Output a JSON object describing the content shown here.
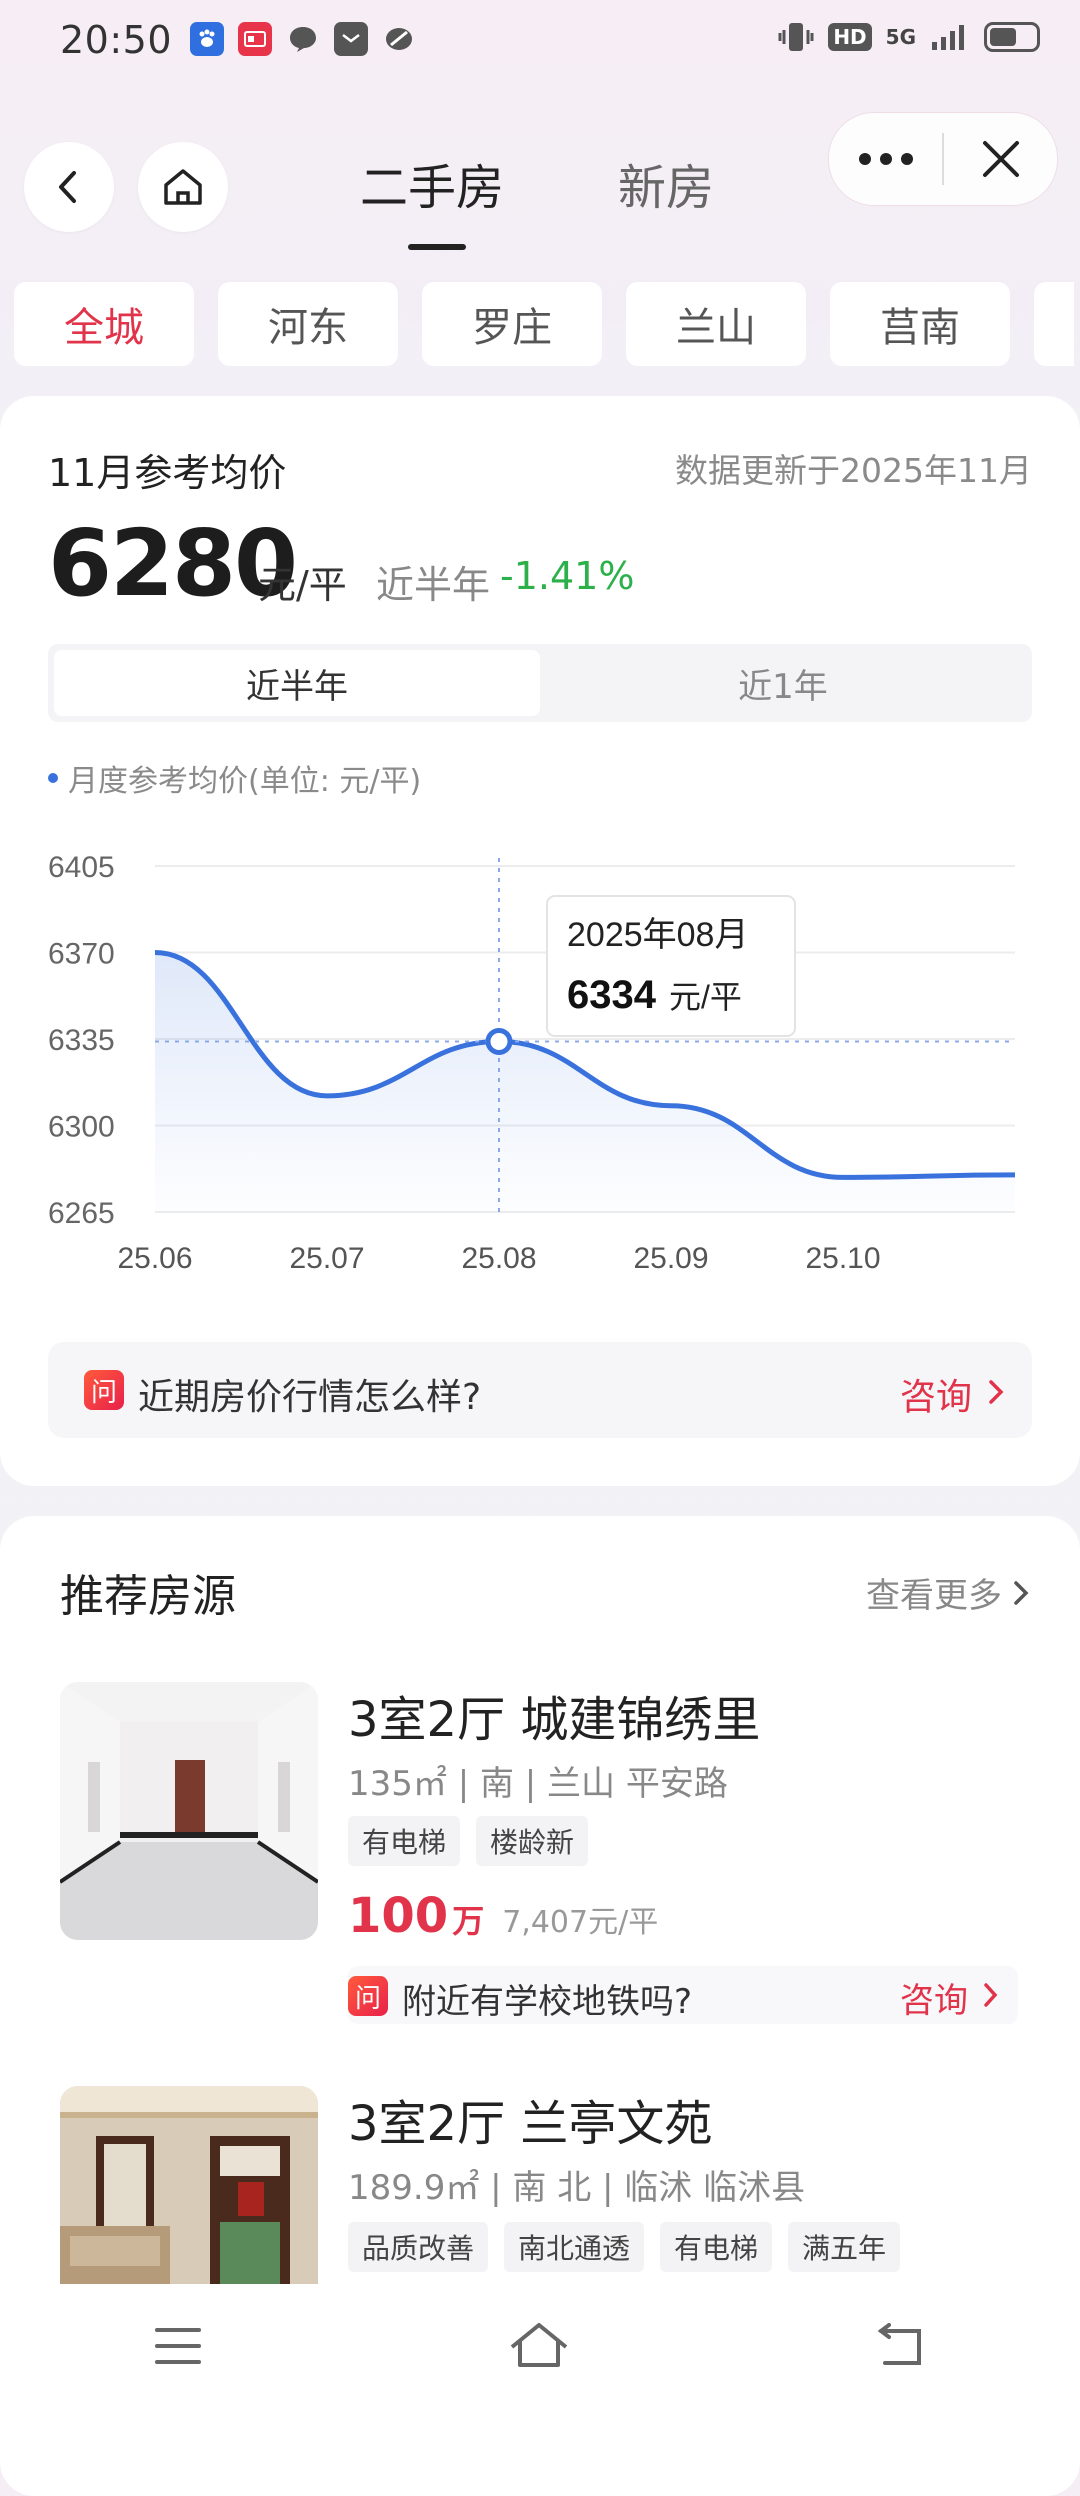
{
  "status": {
    "time": "20:50",
    "hd": "HD",
    "net": "5G"
  },
  "header": {
    "tabs": [
      {
        "label": "二手房"
      },
      {
        "label": "新房"
      }
    ]
  },
  "districts": [
    "全城",
    "河东",
    "罗庄",
    "兰山",
    "莒南"
  ],
  "price": {
    "title": "11月参考均价",
    "update": "数据更新于2025年11月",
    "value": "6280",
    "unit": "元/平",
    "change_label": "近半年",
    "change": "-1.41%",
    "ranges": [
      "近半年",
      "近1年"
    ],
    "legend": "月度参考均价(单位: 元/平)",
    "tooltip": {
      "date": "2025年08月",
      "value": "6334",
      "unit": "元/平"
    },
    "ask": {
      "text": "近期房价行情怎么样?",
      "action": "咨询",
      "icon_char": "问"
    }
  },
  "chart_data": {
    "type": "line",
    "x": [
      "25.06",
      "25.07",
      "25.08",
      "25.09",
      "25.10",
      "25.11"
    ],
    "xticks": [
      "25.06",
      "25.07",
      "25.08",
      "25.09",
      "25.10"
    ],
    "series": [
      {
        "values": [
          6370,
          6312,
          6334,
          6308,
          6279,
          6280
        ]
      }
    ],
    "yticks": [
      6405,
      6370,
      6335,
      6300,
      6265
    ],
    "ylim": [
      6265,
      6405
    ],
    "highlight_index": 2,
    "line_color": "#3a72dd"
  },
  "recommend": {
    "title": "推荐房源",
    "more": "查看更多",
    "listings": [
      {
        "title": "3室2厅 城建锦绣里",
        "meta": "135㎡ | 南 | 兰山 平安路",
        "tags": [
          "有电梯",
          "楼龄新"
        ],
        "price": "100",
        "price_unit": "万",
        "unit_price": "7,407元/平",
        "ask": "附近有学校地铁吗?",
        "ask_action": "咨询"
      },
      {
        "title": "3室2厅 兰亭文苑",
        "meta": "189.9㎡ | 南 北 | 临沭 临沭县",
        "tags": [
          "品质改善",
          "南北通透",
          "有电梯",
          "满五年"
        ]
      }
    ]
  }
}
